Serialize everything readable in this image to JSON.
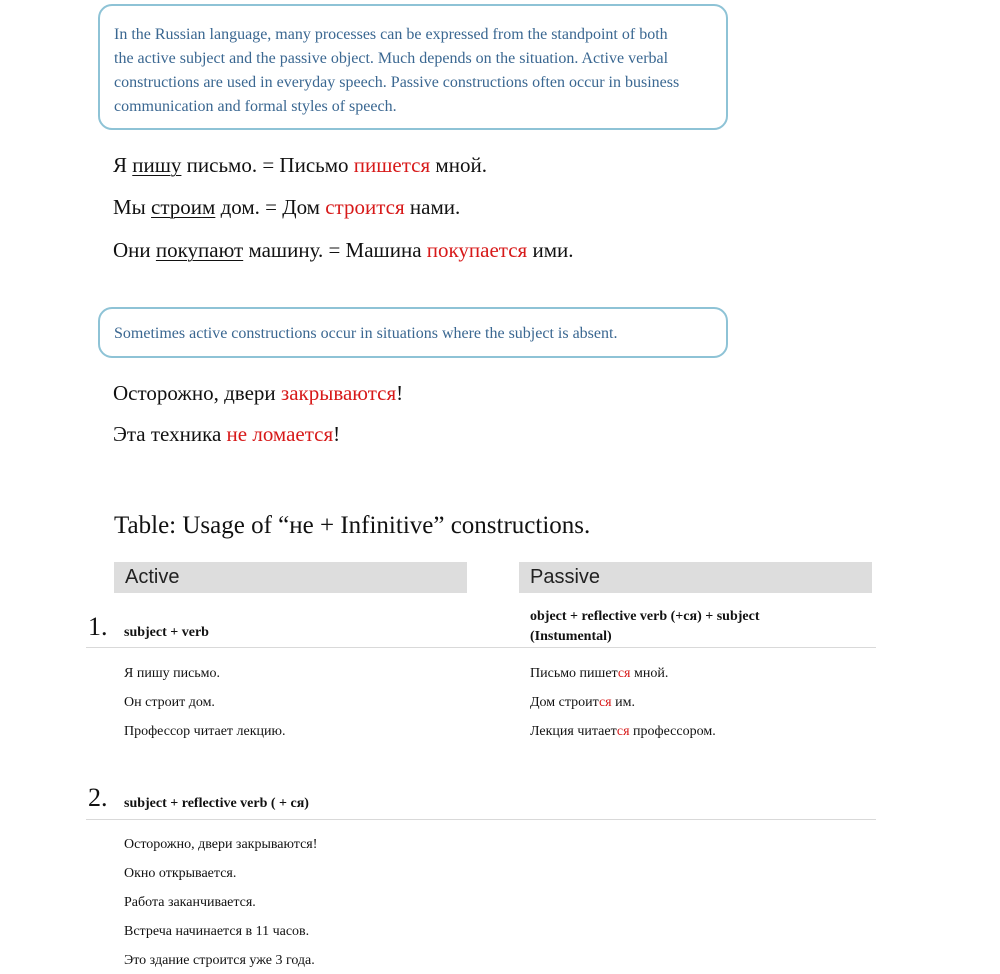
{
  "note1": {
    "lines": [
      "In the Russian language, many processes can be expressed from the standpoint of both",
      "the active subject and the passive object. Much depends on the situation. Active verbal",
      "constructions are used in everyday speech. Passive constructions often occur in business",
      "communication and formal styles of speech."
    ]
  },
  "sentences_a": [
    {
      "pre": "Я ",
      "verb": "пишу",
      "mid": " письмо. = Письмо ",
      "red": "пишется",
      "post": " мной."
    },
    {
      "pre": "Мы ",
      "verb": "строим",
      "mid": " дом. = Дом ",
      "red": "строится",
      "post": " нами."
    },
    {
      "pre": "Они ",
      "verb": "покупают",
      "mid": " машину. = Машина ",
      "red": "покупается",
      "post": " ими."
    }
  ],
  "note2": {
    "text": "Sometimes active constructions occur in situations where the subject is absent."
  },
  "sentences_b": [
    {
      "pre": "Осторожно, двери ",
      "red": "закрываются",
      "post": "!"
    },
    {
      "pre": "Эта техника ",
      "red": "не ломается",
      "post": "!"
    }
  ],
  "table": {
    "title": "Table: Usage of “не + Infinitive” constructions.",
    "header_active": "Active",
    "header_passive": "Passive",
    "row1": {
      "num": "1.",
      "rule_active": "subject + verb",
      "rule_passive_line1": "object + reflective verb (+ся) + subject",
      "rule_passive_line2": "(Instumental)",
      "active_examples": [
        "Я пишу письмо.",
        "Он строит дом.",
        "Профессор читает лекцию."
      ],
      "passive_examples": [
        {
          "pre": "Письмо пишет",
          "red": "ся",
          "post": " мной."
        },
        {
          "pre": "Дом строит",
          "red": "ся",
          "post": " им."
        },
        {
          "pre": "Лекция читает",
          "red": "ся",
          "post": " профессором."
        }
      ]
    },
    "row2": {
      "num": "2.",
      "rule": "subject + reflective verb ( + ся)",
      "examples": [
        "Осторожно, двери закрываются!",
        "Окно открывается.",
        "Работа заканчивается.",
        "Встреча начинается в 11 часов.",
        "Это здание строится уже 3 года."
      ]
    }
  },
  "colors": {
    "note_text": "#3a6791",
    "note_border": "#8ec3d6",
    "highlight_red": "#d71919",
    "header_bg": "#dddddd"
  }
}
